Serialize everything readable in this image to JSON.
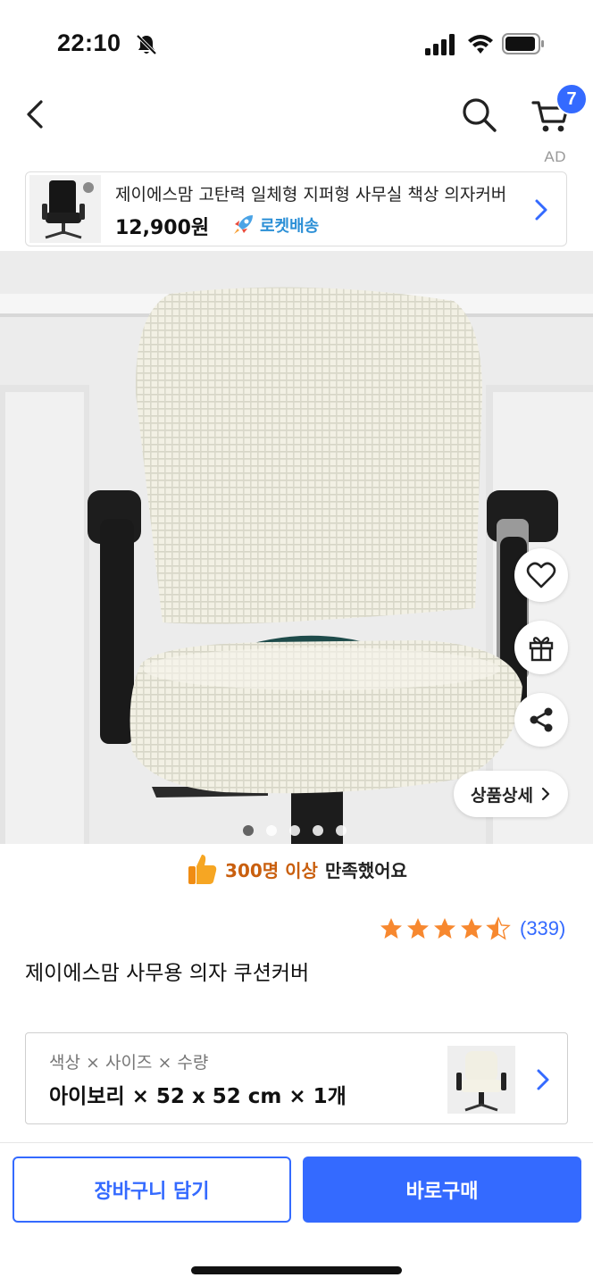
{
  "status_bar": {
    "time": "22:10"
  },
  "header": {
    "cart_count": "7",
    "ad_label": "AD"
  },
  "ad_banner": {
    "title": "제이에스맘 고탄력 일체형 지퍼형 사무실 책상 의자커버",
    "price": "12,900원",
    "delivery_label": "로켓배송"
  },
  "gallery": {
    "detail_button_label": "상품상세",
    "page_count": 5,
    "active_index": 0
  },
  "satisfaction": {
    "highlight": "300명 이상",
    "rest": "만족했어요"
  },
  "product": {
    "rating": 4.5,
    "review_count": "(339)",
    "title": "제이에스맘 사무용 의자 쿠션커버"
  },
  "option": {
    "label": "색상 × 사이즈 × 수량",
    "value": "아이보리 × 52 x 52 cm × 1개"
  },
  "bottom_bar": {
    "cart_button_label": "장바구니 담기",
    "buy_button_label": "바로구매"
  },
  "colors": {
    "accent": "#346aff",
    "highlight": "#c95f0e",
    "rocket": "#2b8fd6",
    "star": "#f7882f"
  }
}
